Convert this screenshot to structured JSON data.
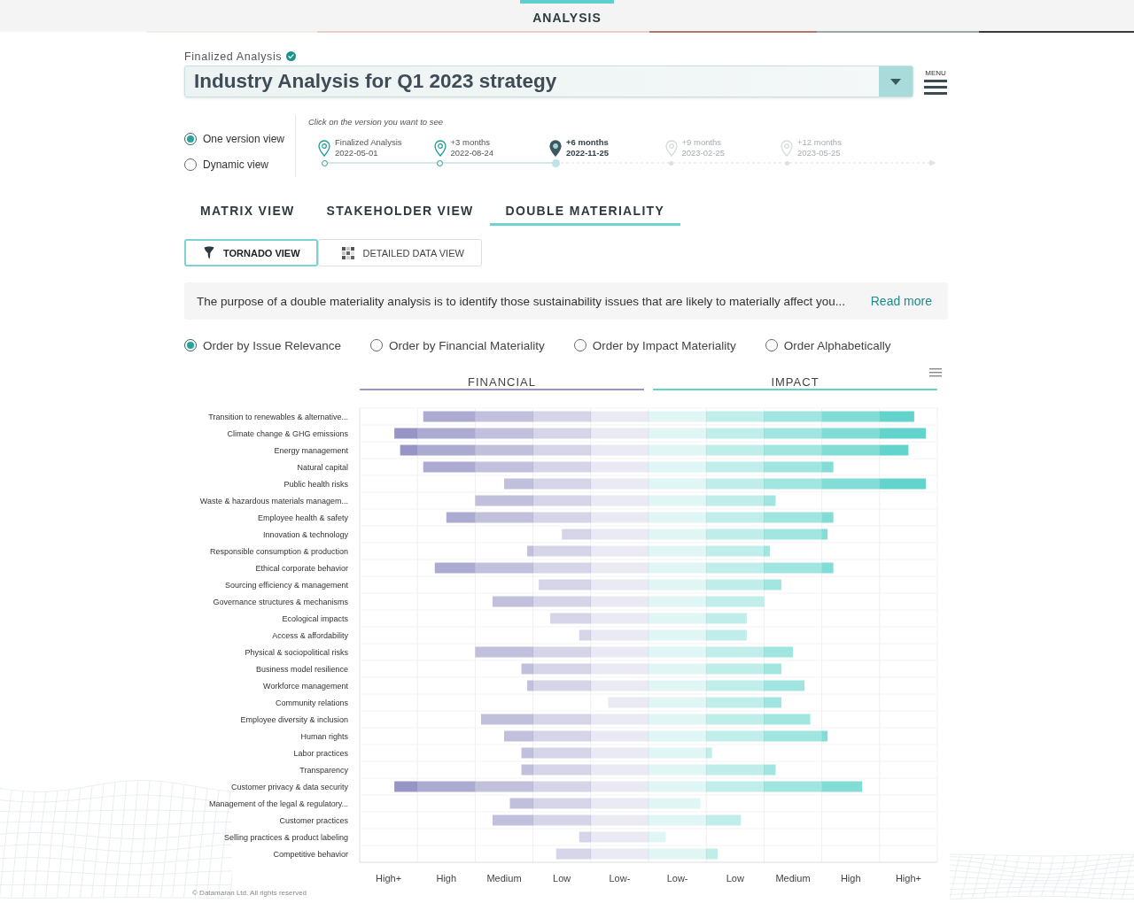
{
  "header": {
    "tabs": [
      {
        "label": "ANALYSIS",
        "selected": true
      }
    ]
  },
  "analysis": {
    "status": "Finalized Analysis",
    "verified": true,
    "title": "Industry Analysis for Q1 2023 strategy",
    "menu_label": "MENU"
  },
  "view_modes": [
    {
      "label": "One version view",
      "selected": true
    },
    {
      "label": "Dynamic view",
      "selected": false
    }
  ],
  "timeline": {
    "hint": "Click on the version you want to see",
    "versions": [
      {
        "label": "Finalized Analysis",
        "date": "2022-05-01",
        "selected": false,
        "disabled": false
      },
      {
        "label": "+3 months",
        "date": "2022-08-24",
        "selected": false,
        "disabled": false
      },
      {
        "label": "+6 months",
        "date": "2022-11-25",
        "selected": true,
        "disabled": false
      },
      {
        "label": "+9 months",
        "date": "2023-02-25",
        "selected": false,
        "disabled": true
      },
      {
        "label": "+12 months",
        "date": "2023-05-25",
        "selected": false,
        "disabled": true
      }
    ]
  },
  "tabs": [
    {
      "label": "MATRIX VIEW",
      "selected": false
    },
    {
      "label": "STAKEHOLDER VIEW",
      "selected": false
    },
    {
      "label": "DOUBLE MATERIALITY",
      "selected": true
    }
  ],
  "view_toggle": [
    {
      "label": "TORNADO VIEW",
      "kind": "tornado",
      "selected": true
    },
    {
      "label": "DETAILED DATA VIEW",
      "kind": "grid",
      "selected": false
    }
  ],
  "description": {
    "text": "The purpose of a double materiality analysis is to identify those sustainability issues that are likely to materially affect you...",
    "link": "Read more"
  },
  "ordering": [
    {
      "label": "Order by Issue Relevance",
      "selected": true
    },
    {
      "label": "Order by Financial Materiality",
      "selected": false
    },
    {
      "label": "Order by Impact Materiality",
      "selected": false
    },
    {
      "label": "Order Alphabetically",
      "selected": false
    }
  ],
  "chart": {
    "headings": [
      "FINANCIAL",
      "IMPACT"
    ],
    "issues": [
      "Transition to renewables & alternative...",
      "Climate change & GHG emissions",
      "Energy management",
      "Natural capital",
      "Public health risks",
      "Waste & hazardous materials managem...",
      "Employee health & safety",
      "Innovation & technology",
      "Responsible consumption & production",
      "Ethical corporate behavior",
      "Sourcing efficiency & management",
      "Governance structures & mechanisms",
      "Ecological impacts",
      "Access & affordability",
      "Physical & sociopolitical risks",
      "Business model resilience",
      "Workforce management",
      "Community relations",
      "Employee diversity & inclusion",
      "Human rights",
      "Labor practices",
      "Transparency",
      "Customer privacy & data security",
      "Management of the legal & regulatory...",
      "Customer practices",
      "Selling practices & product labeling",
      "Competitive behavior"
    ],
    "scale_labels": [
      "High+",
      "High",
      "Medium",
      "Low",
      "Low-",
      "Low-",
      "Low",
      "Medium",
      "High",
      "High+"
    ]
  },
  "footer": {
    "text": "© Datamaran Ltd. All rights reserved"
  }
}
